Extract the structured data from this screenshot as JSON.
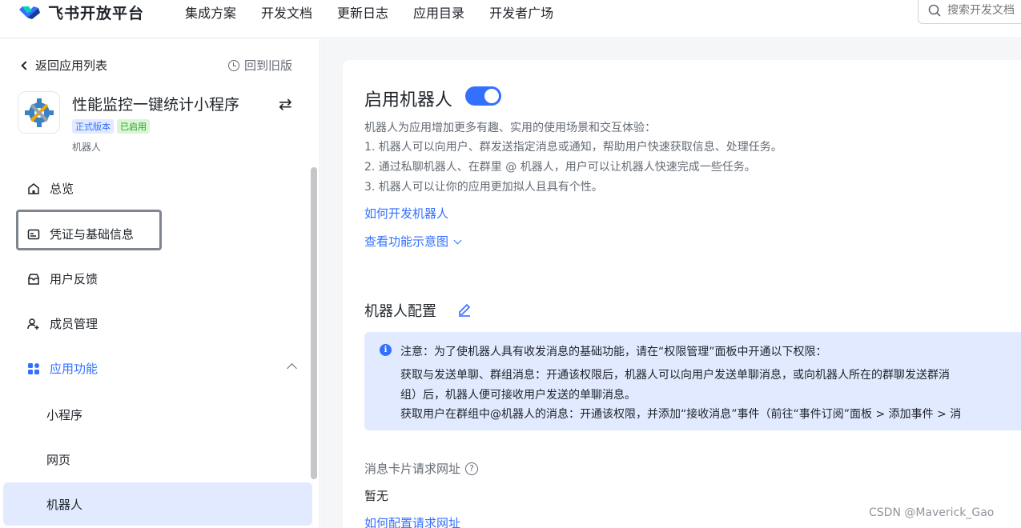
{
  "header": {
    "logo_text": "飞书开放平台",
    "nav": [
      "集成方案",
      "开发文档",
      "更新日志",
      "应用目录",
      "开发者广场"
    ],
    "search_placeholder": "搜索开发文档"
  },
  "sidebar": {
    "back_label": "返回应用列表",
    "old_version_label": "回到旧版",
    "app": {
      "name": "性能监控一键统计小程序",
      "badge_release": "正式版本",
      "badge_status": "已启用",
      "type": "机器人"
    },
    "menu": {
      "overview": "总览",
      "credentials": "凭证与基础信息",
      "feedback": "用户反馈",
      "members": "成员管理",
      "features": "应用功能"
    },
    "sub_menu": {
      "mini_program": "小程序",
      "web": "网页",
      "bot": "机器人"
    }
  },
  "main": {
    "enable_bot": {
      "title": "启用机器人",
      "enabled": true,
      "desc_intro": "机器人为应用增加更多有趣、实用的使用场景和交互体验：",
      "desc_1": "1. 机器人可以向用户、群发送指定消息或通知，帮助用户快速获取信息、处理任务。",
      "desc_2": "2. 通过私聊机器人、在群里 @ 机器人，用户可以让机器人快速完成一些任务。",
      "desc_3": "3. 机器人可以让你的应用更加拟人且具有个性。",
      "link_how_to": "如何开发机器人",
      "link_diagram": "查看功能示意图"
    },
    "bot_config": {
      "title": "机器人配置",
      "notice_title": "注意：为了使机器人具有收发消息的基础功能，请在“权限管理”面板中开通以下权限：",
      "notice_line_1": "获取与发送单聊、群组消息：开通该权限后，机器人可以向用户发送单聊消息，或向机器人所在的群聊发送群消",
      "notice_line_2": "组）后，机器人便可接收用户发送的单聊消息。",
      "notice_line_3": "获取用户在群组中@机器人的消息：开通该权限，并添加“接收消息”事件（前往“事件订阅”面板 > 添加事件 > 消",
      "card_url_label": "消息卡片请求网址",
      "card_url_value": "暂无",
      "card_url_link": "如何配置请求网址"
    }
  },
  "watermark": "CSDN @Maverick_Gao",
  "colors": {
    "accent": "#3370ff",
    "active_bg": "#e1eaff",
    "page_bg": "#f5f6f7"
  }
}
